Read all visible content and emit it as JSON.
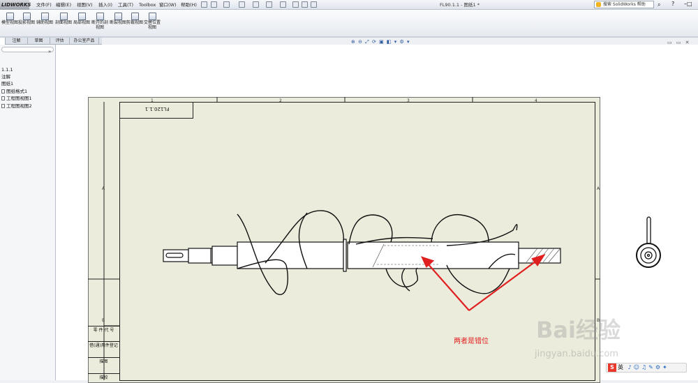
{
  "app": {
    "brand": "LIDWORKS",
    "menus": [
      "文件(F)",
      "编辑(E)",
      "视图(V)",
      "插入(I)",
      "工具(T)",
      "Toolbox",
      "窗口(W)",
      "帮助(H)"
    ],
    "document_title": "FL90.1.1 - 图纸1 *",
    "search_placeholder": "搜索 SolidWorks 帮助"
  },
  "command_manager": {
    "buttons": [
      {
        "label": "模型视图",
        "icon": "model-view-icon"
      },
      {
        "label": "投影视图",
        "icon": "projected-view-icon"
      },
      {
        "label": "辅助视图",
        "icon": "auxiliary-view-icon"
      },
      {
        "label": "剖面视图",
        "icon": "section-view-icon"
      },
      {
        "label": "局部视图",
        "icon": "detail-view-icon"
      },
      {
        "label": "断开的剖视图",
        "icon": "broken-out-section-icon"
      },
      {
        "label": "断裂视图",
        "icon": "break-view-icon"
      },
      {
        "label": "剪裁视图",
        "icon": "crop-view-icon"
      },
      {
        "label": "交替位置视图",
        "icon": "alternate-position-icon"
      }
    ]
  },
  "tabs": [
    "注解",
    "草图",
    "评估",
    "办公室产品"
  ],
  "feature_tree": {
    "items": [
      {
        "label": "1.1.1",
        "icon": "drawing-icon"
      },
      {
        "label": "注解",
        "icon": "annotation-icon"
      },
      {
        "label": "图纸1",
        "icon": "sheet-icon"
      },
      {
        "label": "图纸格式1",
        "icon": "sheet-format-icon"
      },
      {
        "label": "工程图视图1",
        "icon": "drawing-view-icon"
      },
      {
        "label": "工程图视图2",
        "icon": "drawing-view-icon"
      }
    ]
  },
  "sheet": {
    "zone_numbers": [
      "1",
      "2",
      "3",
      "4"
    ],
    "zone_letters": [
      "A",
      "B"
    ],
    "stamp_text": "FL120.1.1",
    "title_block_rows": [
      "零 件 代 号",
      "借(通)用件登记",
      "描图",
      "描校"
    ]
  },
  "annotation": {
    "text": "两者是错位",
    "color": "#e02020"
  },
  "watermark": {
    "logo": "Bai经验",
    "url": "jingyan.baidu.com"
  },
  "ime_bar": {
    "badge": "S",
    "label": "英"
  }
}
